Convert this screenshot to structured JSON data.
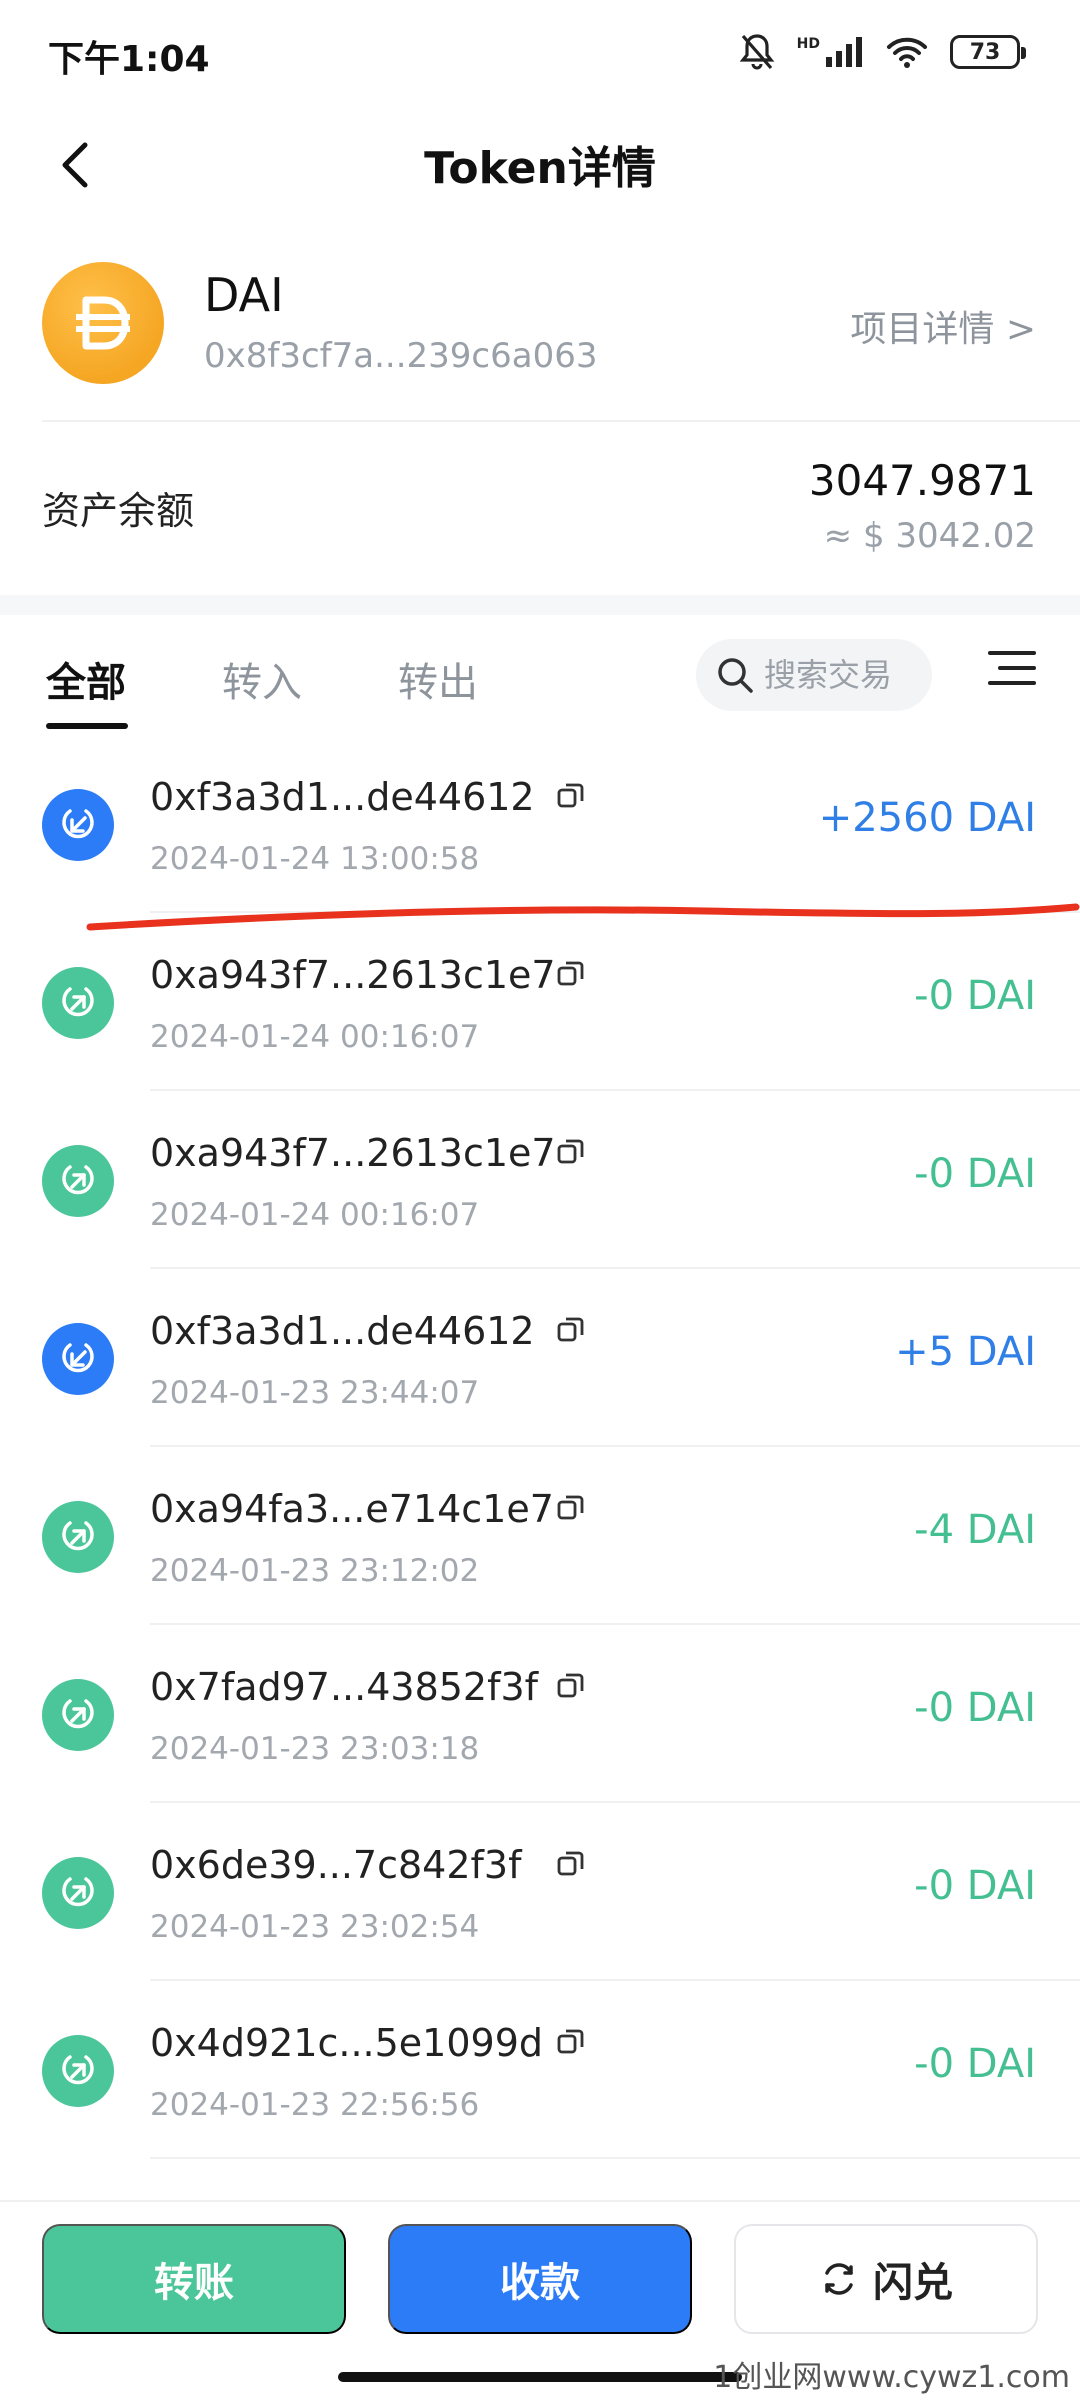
{
  "status_bar": {
    "time": "下午1:04",
    "hd": "HD",
    "battery": "73"
  },
  "nav": {
    "title": "Token详情"
  },
  "token": {
    "name": "DAI",
    "address": "0x8f3cf7a...239c6a063",
    "project_link": "项目详情 >",
    "balance_label": "资产余额",
    "balance_amount": "3047.9871",
    "balance_fiat": "≈ $ 3042.02"
  },
  "tabs": [
    {
      "label": "全部",
      "active": true
    },
    {
      "label": "转入",
      "active": false
    },
    {
      "label": "转出",
      "active": false
    }
  ],
  "search": {
    "placeholder": "搜索交易"
  },
  "transactions": [
    {
      "direction": "in",
      "hash": "0xf3a3d1...de44612",
      "time": "2024-01-24 13:00:58",
      "amount": "+2560 DAI"
    },
    {
      "direction": "out",
      "hash": "0xa943f7...2613c1e7",
      "time": "2024-01-24 00:16:07",
      "amount": "-0 DAI"
    },
    {
      "direction": "out",
      "hash": "0xa943f7...2613c1e7",
      "time": "2024-01-24 00:16:07",
      "amount": "-0 DAI"
    },
    {
      "direction": "in",
      "hash": "0xf3a3d1...de44612",
      "time": "2024-01-23 23:44:07",
      "amount": "+5 DAI"
    },
    {
      "direction": "out",
      "hash": "0xa94fa3...e714c1e7",
      "time": "2024-01-23 23:12:02",
      "amount": "-4 DAI"
    },
    {
      "direction": "out",
      "hash": "0x7fad97...43852f3f",
      "time": "2024-01-23 23:03:18",
      "amount": "-0 DAI"
    },
    {
      "direction": "out",
      "hash": "0x6de39...7c842f3f",
      "time": "2024-01-23 23:02:54",
      "amount": "-0 DAI"
    },
    {
      "direction": "out",
      "hash": "0x4d921c...5e1099d",
      "time": "2024-01-23 22:56:56",
      "amount": "-0 DAI"
    }
  ],
  "actions": {
    "transfer": "转账",
    "receive": "收款",
    "swap": "闪兑"
  },
  "watermark": "1创业网www.cywz1.com",
  "colors": {
    "in": "#2b7cf6",
    "out": "#4bc69a",
    "token": "#f5a623",
    "annotation": "#e8321e"
  }
}
